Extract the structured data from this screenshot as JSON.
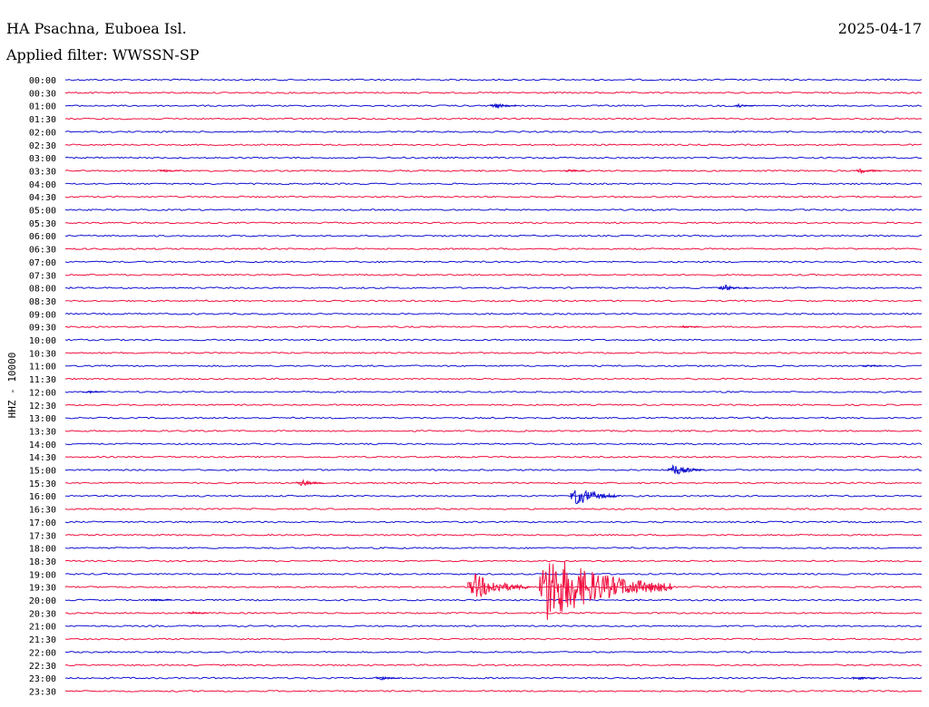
{
  "header": {
    "station": "HA Psachna, Euboea Isl.",
    "date": "2025-04-17",
    "filter": "Applied filter: WWSSN-SP",
    "channel_label": "HHZ - 10000"
  },
  "colors": {
    "even_rows": "#1010d0",
    "odd_rows": "#f01040",
    "text": "#000000",
    "background": "#ffffff"
  },
  "chart_data": {
    "type": "line",
    "title": "HA Psachna, Euboea Isl.",
    "subtitle": "Applied filter: WWSSN-SP",
    "ylabel": "HHZ - 10000",
    "xlabel": "",
    "grid": false,
    "legend": "none",
    "x_minutes_per_row": 30,
    "row_labels": [
      "00:00",
      "00:30",
      "01:00",
      "01:30",
      "02:00",
      "02:30",
      "03:00",
      "03:30",
      "04:00",
      "04:30",
      "05:00",
      "05:30",
      "06:00",
      "06:30",
      "07:00",
      "07:30",
      "08:00",
      "08:30",
      "09:00",
      "09:30",
      "10:00",
      "10:30",
      "11:00",
      "11:30",
      "12:00",
      "12:30",
      "13:00",
      "13:30",
      "14:00",
      "14:30",
      "15:00",
      "15:30",
      "16:00",
      "16:30",
      "17:00",
      "17:30",
      "18:00",
      "18:30",
      "19:00",
      "19:30",
      "20:00",
      "20:30",
      "21:00",
      "21:30",
      "22:00",
      "22:30",
      "23:00",
      "23:30"
    ],
    "events": [
      {
        "row": "01:00",
        "minute": 15.0,
        "amplitude": 0.25
      },
      {
        "row": "01:00",
        "minute": 23.5,
        "amplitude": 0.15
      },
      {
        "row": "03:30",
        "minute": 3.4,
        "amplitude": 0.12
      },
      {
        "row": "03:30",
        "minute": 17.6,
        "amplitude": 0.12
      },
      {
        "row": "03:30",
        "minute": 27.8,
        "amplitude": 0.25
      },
      {
        "row": "08:00",
        "minute": 23.0,
        "amplitude": 0.35
      },
      {
        "row": "09:30",
        "minute": 21.6,
        "amplitude": 0.12
      },
      {
        "row": "12:00",
        "minute": 0.7,
        "amplitude": 0.15
      },
      {
        "row": "11:00",
        "minute": 28.0,
        "amplitude": 0.12
      },
      {
        "row": "15:00",
        "minute": 21.2,
        "amplitude": 0.55
      },
      {
        "row": "15:30",
        "minute": 8.2,
        "amplitude": 0.3
      },
      {
        "row": "16:00",
        "minute": 17.8,
        "amplitude": 0.85
      },
      {
        "row": "19:30",
        "minute": 14.2,
        "amplitude": 1.2
      },
      {
        "row": "19:30",
        "minute": 16.7,
        "amplitude": 3.0
      },
      {
        "row": "20:00",
        "minute": 3.1,
        "amplitude": 0.12
      },
      {
        "row": "20:30",
        "minute": 4.4,
        "amplitude": 0.12
      },
      {
        "row": "23:00",
        "minute": 11.0,
        "amplitude": 0.2
      },
      {
        "row": "23:00",
        "minute": 27.7,
        "amplitude": 0.18
      }
    ]
  }
}
